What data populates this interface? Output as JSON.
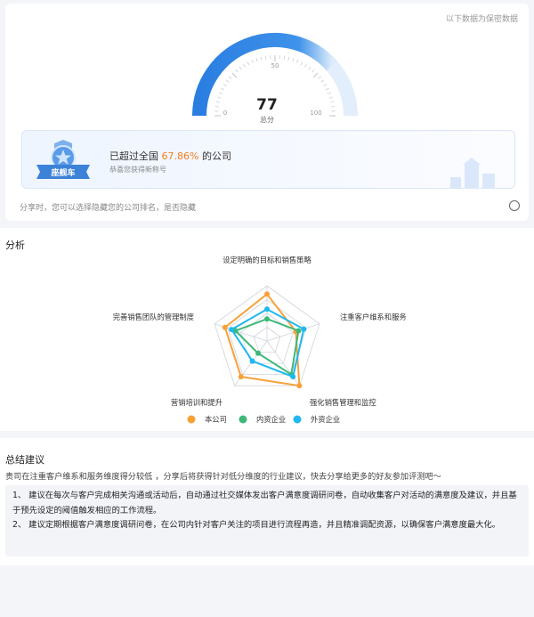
{
  "header": {
    "disclaimer": "以下数据为保密数据"
  },
  "gauge": {
    "score": "77",
    "score_label": "总分",
    "tick_min": "0",
    "tick_mid": "50",
    "tick_max": "100",
    "value_fraction": 0.77,
    "accent": "#2a7ee0"
  },
  "rank": {
    "prefix": "已超过全国 ",
    "percent": "67.86%",
    "suffix": " 的公司",
    "sub": "恭喜您获得新称号",
    "badge_label": "座舰车",
    "percent_color": "#f57c1f"
  },
  "share": {
    "note": "分享时，您可以选择隐藏您的公司排名，是否隐藏"
  },
  "analysis": {
    "title": "分析",
    "chart_data": {
      "type": "radar",
      "axes": [
        "设定明确的目标和销售策略",
        "注重客户维系和服务",
        "强化销售管理和监控",
        "营销培训和提升",
        "完善销售团队的管理制度"
      ],
      "max": 4,
      "series": [
        {
          "name": "本公司",
          "color": "#f7a13a",
          "values": [
            3.4,
            2.2,
            4.0,
            3.2,
            3.2
          ]
        },
        {
          "name": "内资企业",
          "color": "#3db87a",
          "values": [
            1.6,
            2.4,
            3.0,
            1.1,
            2.4
          ]
        },
        {
          "name": "外资企业",
          "color": "#1fb8f0",
          "values": [
            2.3,
            2.8,
            3.2,
            1.8,
            2.7
          ]
        }
      ]
    }
  },
  "summary": {
    "title": "总结建议",
    "intro": "贵司在注重客户维系和服务维度得分较低 ，分享后将获得针对低分维度的行业建议，快去分享给更多的好友参加评测吧～",
    "advice": [
      "1、 建议在每次与客户完成相关沟通或活动后，自动通过社交媒体发出客户满意度调研问卷，自动收集客户对活动的满意度及建议，并且基于预先设定的阈值触发相应的工作流程。",
      "2、 建议定期根据客户满意度调研问卷，在公司内针对客户关注的项目进行流程再造，并且精准调配资源，以确保客户满意度最大化。"
    ]
  }
}
